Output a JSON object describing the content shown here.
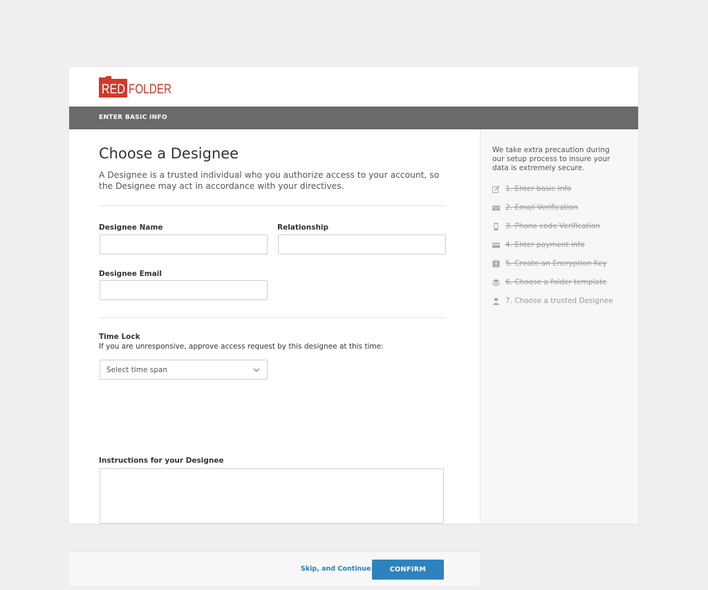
{
  "brand": {
    "logo_red": "RED",
    "logo_rest": "FOLDER",
    "colors": {
      "logo_red": "#d2382b",
      "accent_blue": "#2f83bd",
      "section_bar": "#6a6a6a"
    }
  },
  "section_bar": {
    "label": "ENTER BASIC INFO"
  },
  "main": {
    "title": "Choose a Designee",
    "description": "A Designee is a trusted individual who you authorize access to your account, so the Designee may act in accordance with your directives.",
    "fields": {
      "designee_name": {
        "label": "Designee Name",
        "value": ""
      },
      "relationship": {
        "label": "Relationship",
        "value": ""
      },
      "designee_email": {
        "label": "Designee Email",
        "value": ""
      }
    },
    "time_lock": {
      "label": "Time Lock",
      "hint": "If you are unresponsive, approve access request by this designee at this time:",
      "select_value": "Select time span"
    },
    "instructions": {
      "label": "Instructions for your Designee",
      "value": ""
    }
  },
  "footer": {
    "skip_label": "Skip, and Continue",
    "confirm_label": "CONFIRM"
  },
  "aside": {
    "note": "We take extra precaution during our setup process to insure your data is extremely secure.",
    "steps": [
      {
        "label": "1. Enter basic Info",
        "icon": "edit-icon",
        "completed": true
      },
      {
        "label": "2. Email Verification",
        "icon": "envelope-icon",
        "completed": true
      },
      {
        "label": "3. Phone code Verification",
        "icon": "phone-icon",
        "completed": true
      },
      {
        "label": "4. Enter payment info",
        "icon": "credit-card-icon",
        "completed": true
      },
      {
        "label": "5. Create an Encryption Key",
        "icon": "key-icon",
        "completed": true
      },
      {
        "label": "6. Choose a folder template",
        "icon": "layers-icon",
        "completed": true
      },
      {
        "label": "7. Choose a trusted Designee",
        "icon": "user-icon",
        "completed": false
      }
    ]
  }
}
